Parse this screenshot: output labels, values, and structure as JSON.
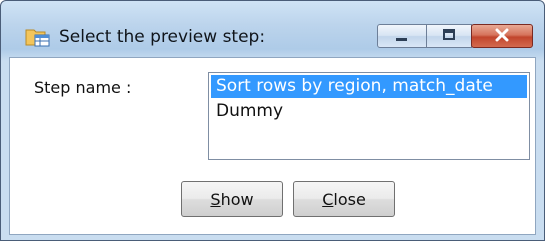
{
  "window": {
    "title": "Select the preview step:",
    "controls": {
      "minimize": "minimize",
      "maximize": "maximize",
      "close": "close"
    }
  },
  "form": {
    "step_label": "Step name :",
    "steps": [
      {
        "label": "Sort rows by region, match_date",
        "selected": true
      },
      {
        "label": "Dummy",
        "selected": false
      }
    ]
  },
  "buttons": {
    "show_mnemonic": "S",
    "show_rest": "how",
    "close_mnemonic": "C",
    "close_rest": "lose"
  },
  "colors": {
    "selection": "#3399ff",
    "close_button": "#c1452c"
  },
  "icons": {
    "app": "folder-table-icon",
    "minimize": "minimize-icon",
    "maximize": "maximize-icon",
    "close": "close-icon"
  }
}
